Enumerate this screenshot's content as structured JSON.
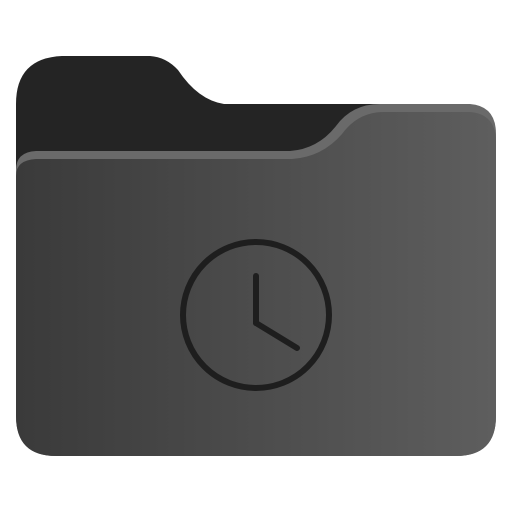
{
  "icon": {
    "name": "folder-recent-icon",
    "symbol": "clock-icon"
  },
  "colors": {
    "background": "#ffffff",
    "folder_back": "#242424",
    "folder_front_left": "#3a3a3a",
    "folder_front_right": "#5e5e5e",
    "front_highlight": "#6a6a6a",
    "glyph": "#1e1e1e"
  }
}
